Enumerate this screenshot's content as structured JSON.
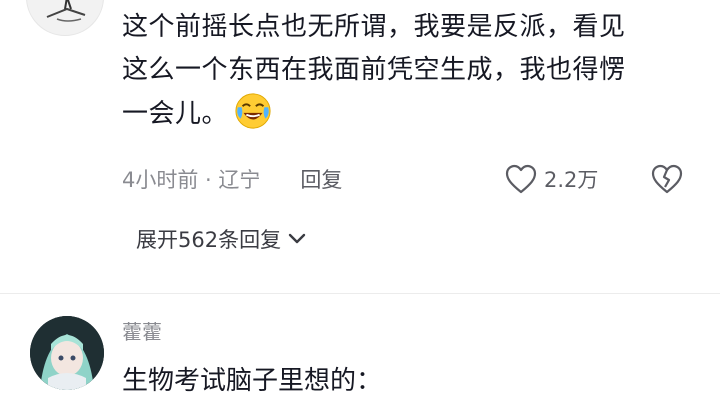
{
  "comment1": {
    "lines": [
      "这个前摇长点也无所谓，我要是反派，看见",
      "这么一个东西在我面前凭空生成，我也得愣",
      "一会儿。"
    ],
    "emoji": "crying-laughing-emoji",
    "time_location": "4小时前 · 辽宁",
    "reply_label": "回复",
    "like_count": "2.2万",
    "expand_label": "展开562条回复"
  },
  "comment2": {
    "username": "藿藿",
    "text": "生物考试脑子里想的："
  },
  "colors": {
    "text": "#161823",
    "meta": "#8a8b91",
    "divider": "#ececec"
  }
}
